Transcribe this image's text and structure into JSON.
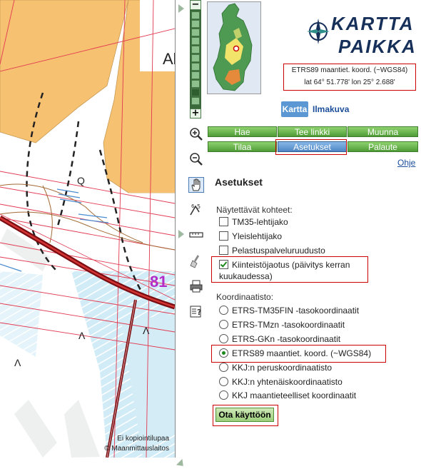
{
  "map": {
    "labels": {
      "ala": "Ala",
      "road_number": "81",
      "q": "Q",
      "lambda": "Λ"
    },
    "credit_line1": "Ei kopiointilupaa",
    "credit_line2": "© Maanmittauslaitos"
  },
  "zoom": {
    "plus": "+",
    "minus": "−",
    "level_steps": 11,
    "current_step": 9
  },
  "logo": {
    "line1": "KARTTA",
    "line2": "PAIKKA"
  },
  "coords": {
    "system": "ETRS89 maantiet. koord. (~WGS84)",
    "value": "lat 64° 51.778'  lon 25° 2.688'"
  },
  "map_tabs": {
    "map": "Kartta",
    "aerial": "Ilmakuva"
  },
  "toolbar": {
    "row1": [
      "Hae",
      "Tee linkki",
      "Muunna"
    ],
    "row2": [
      "Tilaa",
      "Asetukset",
      "Palaute"
    ],
    "active": "Asetukset",
    "help": "Ohje"
  },
  "settings": {
    "title": "Asetukset",
    "shown_label": "Näytettävät kohteet:",
    "shown_items": [
      {
        "label": "TM35-lehtijako",
        "checked": false
      },
      {
        "label": "Yleislehtijako",
        "checked": false
      },
      {
        "label": "Pelastuspalveluruudusto",
        "checked": false
      },
      {
        "label_line1": "Kiinteistöjaotus (päivitys kerran",
        "label_line2": "kuukaudessa)",
        "checked": true
      }
    ],
    "coord_label": "Koordinaatisto:",
    "coord_items": [
      {
        "label": "ETRS-TM35FIN -tasokoordinaatit",
        "selected": false
      },
      {
        "label": "ETRS-TMzn -tasokoordinaatit",
        "selected": false
      },
      {
        "label": "ETRS-GKn -tasokoordinaatit",
        "selected": false
      },
      {
        "label": "ETRS89 maantiet. koord. (~WGS84)",
        "selected": true
      },
      {
        "label": "KKJ:n peruskoordinaatisto",
        "selected": false
      },
      {
        "label": "KKJ:n yhtenäiskoordinaatisto",
        "selected": false
      },
      {
        "label": "KKJ maantieteelliset koordinaatit",
        "selected": false
      }
    ],
    "apply": "Ota käyttöön"
  },
  "colors": {
    "map_field": "#f6c170",
    "map_water": "#c9e8f4",
    "map_bg": "#ffffff",
    "parcel_line": "#e23a52",
    "road": "#7a0d12",
    "road_number": "#b42cc8",
    "button_green": "#66b24a",
    "button_active": "#5a97d3",
    "highlight": "#cc0000"
  },
  "icons": [
    "zoom-in-icon",
    "zoom-out-icon",
    "pan-hand-icon",
    "measure-icon",
    "ruler-icon",
    "clear-icon",
    "print-icon",
    "info-icon"
  ]
}
